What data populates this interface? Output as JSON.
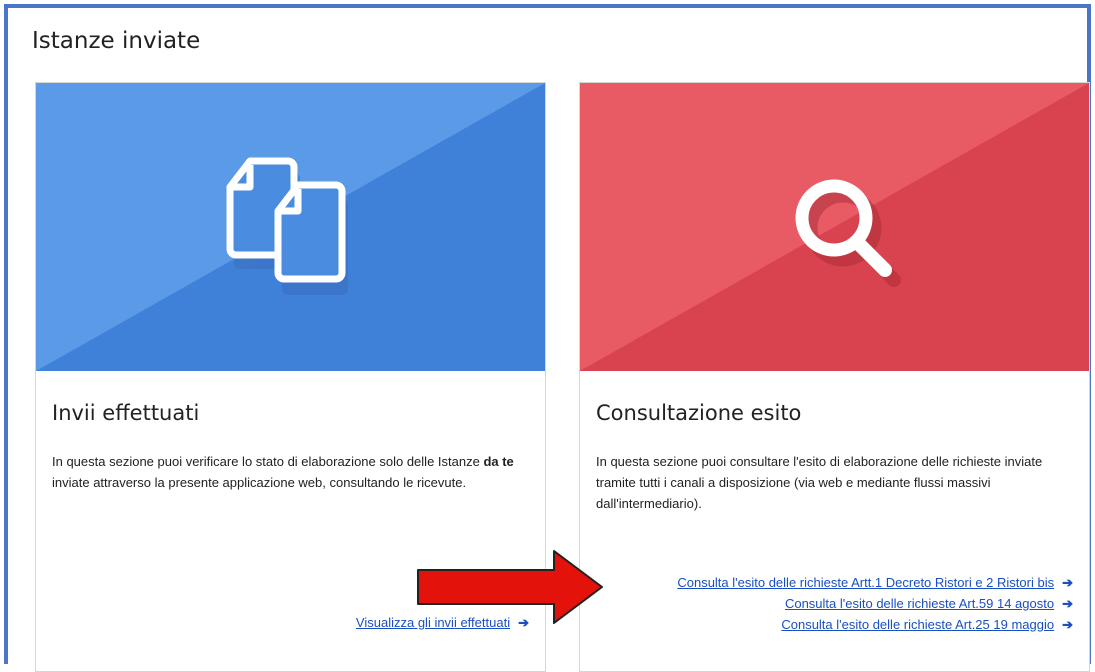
{
  "page": {
    "title": "Istanze inviate"
  },
  "cards": [
    {
      "heading": "Invii effettuati",
      "description_before": "In questa sezione puoi verificare lo stato di elaborazione solo delle Istanze ",
      "description_bold": "da te",
      "description_after": " inviate attraverso la presente applicazione web, consultando le ricevute.",
      "icon": "documents-icon",
      "color": "#4a8de0",
      "links": [
        "Visualizza gli invii effettuati"
      ]
    },
    {
      "heading": "Consultazione esito",
      "description": "In questa sezione puoi consultare l'esito di elaborazione delle richieste inviate tramite tutti i canali a disposizione (via web e mediante flussi massivi dall'intermediario).",
      "icon": "search-icon",
      "color": "#e24c58",
      "links": [
        "Consulta l'esito delle richieste Artt.1 Decreto Ristori e 2 Ristori bis",
        "Consulta l'esito delle richieste Art.59 14 agosto",
        "Consulta l'esito delle richieste Art.25 19 maggio"
      ]
    }
  ],
  "colors": {
    "frame": "#4a76c7",
    "link": "#1a4fc2",
    "annotation_arrow": "#e3120b"
  }
}
